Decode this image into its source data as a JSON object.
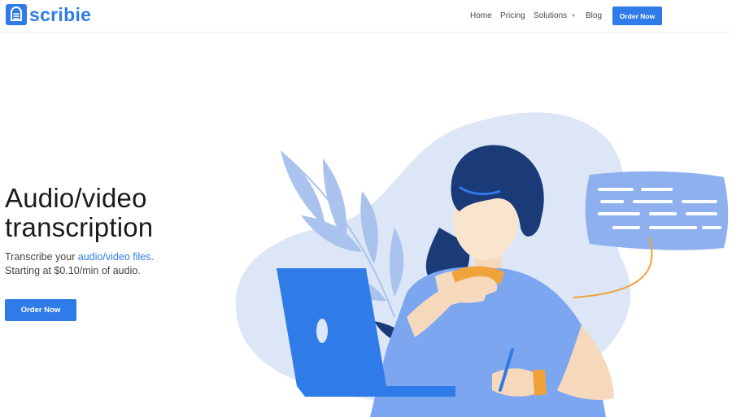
{
  "brand": {
    "name": "scribie",
    "logo_icon": "scribie-logo-icon",
    "color": "#2f7be8"
  },
  "nav": {
    "items": [
      {
        "label": "Home"
      },
      {
        "label": "Pricing"
      },
      {
        "label": "Solutions",
        "has_dropdown": true
      },
      {
        "label": "Blog"
      }
    ],
    "cta_label": "Order Now"
  },
  "hero": {
    "title_line1": "Audio/video",
    "title_line2": "transcription",
    "subtitle_prefix": "Transcribe your ",
    "subtitle_link": "audio/video files.",
    "subtitle_line2": "Starting at $0.10/min of audio.",
    "cta_label": "Order Now"
  },
  "illustration": {
    "name": "woman-at-laptop-illustration"
  },
  "colors": {
    "accent": "#2f7be8",
    "dark_navy": "#1b3a78",
    "light_blue": "#dde6f7",
    "orange": "#f0a33a"
  }
}
